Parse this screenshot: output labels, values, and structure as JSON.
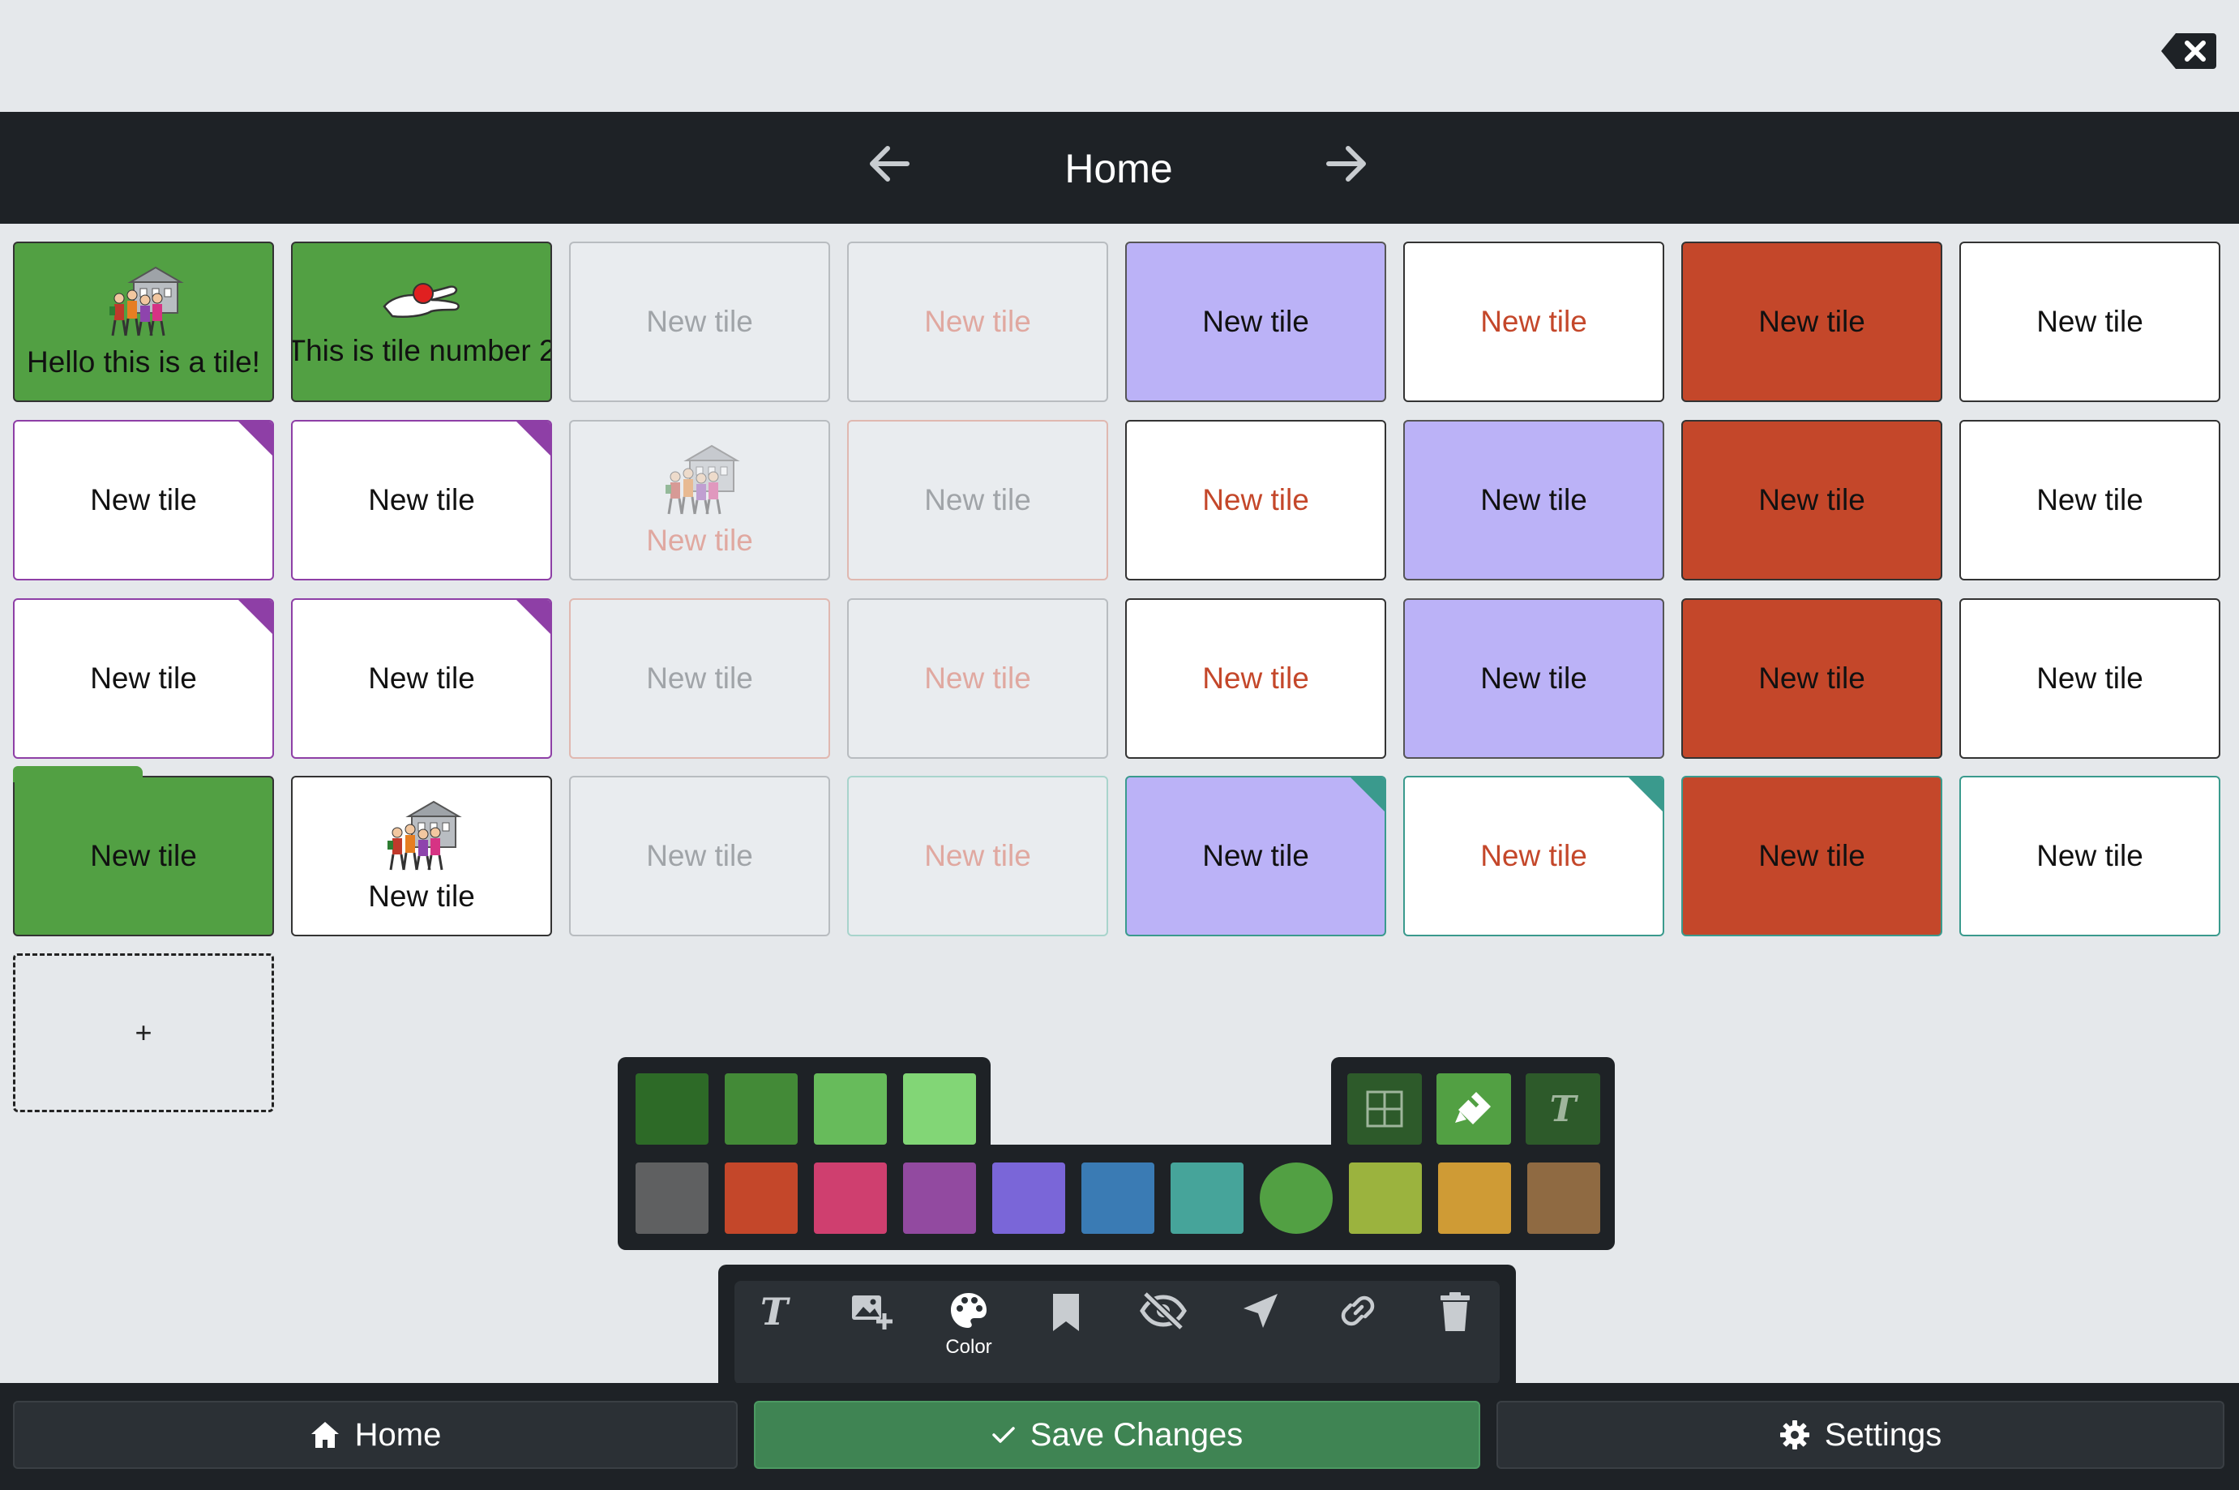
{
  "header": {
    "title": "Home"
  },
  "tiles": [
    {
      "label": "Hello this is a tile!",
      "bg": "#52a043",
      "color": "#111111",
      "border": "#333333",
      "pic": "people-school"
    },
    {
      "label": "This is tile number 2",
      "bg": "#52a043",
      "color": "#111111",
      "border": "#333333",
      "pic": "hand-giving"
    },
    {
      "label": "New tile",
      "bg": "#e9ecef",
      "color": "#a0a4a8",
      "border": "#b8bcc0"
    },
    {
      "label": "New tile",
      "bg": "#e9ecef",
      "color": "#e0a8a0",
      "border": "#b8bcc0"
    },
    {
      "label": "New tile",
      "bg": "#bbb2f7",
      "color": "#111111",
      "border": "#555555"
    },
    {
      "label": "New tile",
      "bg": "#ffffff",
      "color": "#c4472a",
      "border": "#333333"
    },
    {
      "label": "New tile",
      "bg": "#c4472a",
      "color": "#111111",
      "border": "#333333"
    },
    {
      "label": "New tile",
      "bg": "#ffffff",
      "color": "#111111",
      "border": "#333333"
    },
    {
      "label": "New tile",
      "bg": "#ffffff",
      "color": "#111111",
      "border": "#8e3fa6",
      "corner": "purple"
    },
    {
      "label": "New tile",
      "bg": "#ffffff",
      "color": "#111111",
      "border": "#8e3fa6",
      "corner": "purple"
    },
    {
      "label": "New tile",
      "bg": "#e9ecef",
      "color": "#e0a8a0",
      "border": "#b8bcc0",
      "pic": "people-school-faded"
    },
    {
      "label": "New tile",
      "bg": "#e9ecef",
      "color": "#a0a4a8",
      "border": "#e0b8b0"
    },
    {
      "label": "New tile",
      "bg": "#ffffff",
      "color": "#c4472a",
      "border": "#333333"
    },
    {
      "label": "New tile",
      "bg": "#bbb2f7",
      "color": "#111111",
      "border": "#555555"
    },
    {
      "label": "New tile",
      "bg": "#c4472a",
      "color": "#111111",
      "border": "#333333"
    },
    {
      "label": "New tile",
      "bg": "#ffffff",
      "color": "#111111",
      "border": "#333333"
    },
    {
      "label": "New tile",
      "bg": "#ffffff",
      "color": "#111111",
      "border": "#8e3fa6",
      "corner": "purple"
    },
    {
      "label": "New tile",
      "bg": "#ffffff",
      "color": "#111111",
      "border": "#8e3fa6",
      "corner": "purple"
    },
    {
      "label": "New tile",
      "bg": "#e9ecef",
      "color": "#a0a4a8",
      "border": "#e0b8b0"
    },
    {
      "label": "New tile",
      "bg": "#e9ecef",
      "color": "#e0a8a0",
      "border": "#b8bcc0"
    },
    {
      "label": "New tile",
      "bg": "#ffffff",
      "color": "#c4472a",
      "border": "#333333"
    },
    {
      "label": "New tile",
      "bg": "#bbb2f7",
      "color": "#111111",
      "border": "#555555"
    },
    {
      "label": "New tile",
      "bg": "#c4472a",
      "color": "#111111",
      "border": "#333333"
    },
    {
      "label": "New tile",
      "bg": "#ffffff",
      "color": "#111111",
      "border": "#333333"
    },
    {
      "label": "New tile",
      "bg": "#52a043",
      "color": "#111111",
      "border": "#333333",
      "folder": true
    },
    {
      "label": "New tile",
      "bg": "#ffffff",
      "color": "#111111",
      "border": "#333333",
      "pic": "people-school"
    },
    {
      "label": "New tile",
      "bg": "#e9ecef",
      "color": "#a0a4a8",
      "border": "#b8bcc0"
    },
    {
      "label": "New tile",
      "bg": "#e9ecef",
      "color": "#e0a8a0",
      "border": "#a8d4cc"
    },
    {
      "label": "New tile",
      "bg": "#bbb2f7",
      "color": "#111111",
      "border": "#3a9a8d",
      "corner": "teal"
    },
    {
      "label": "New tile",
      "bg": "#ffffff",
      "color": "#c4472a",
      "border": "#3a9a8d",
      "corner": "teal"
    },
    {
      "label": "New tile",
      "bg": "#c4472a",
      "color": "#111111",
      "border": "#3a9a8d"
    },
    {
      "label": "New tile",
      "bg": "#ffffff",
      "color": "#111111",
      "border": "#3a9a8d"
    }
  ],
  "add_tile": {
    "label": "+"
  },
  "palette": {
    "green_shades": [
      "#2d6a27",
      "#438a37",
      "#67bb5b",
      "#82d676"
    ],
    "colors": [
      "#5f6061",
      "#c4472a",
      "#cf3f6f",
      "#924aa0",
      "#7a66d8",
      "#3a7bb4",
      "#46a49a",
      "#52a043",
      "#9bb33e",
      "#cf9b35",
      "#8f6a42"
    ],
    "selected_index": 7,
    "modes": [
      {
        "name": "grid",
        "icon": "grid-icon",
        "bg": "#2d5a2a"
      },
      {
        "name": "fill",
        "icon": "paint-bucket-icon",
        "bg": "#52a043"
      },
      {
        "name": "text",
        "icon": "text-style-icon",
        "bg": "#2d5a2a"
      }
    ]
  },
  "toolbar": {
    "tools": [
      {
        "icon": "text-icon",
        "label": ""
      },
      {
        "icon": "add-image-icon",
        "label": ""
      },
      {
        "icon": "palette-icon",
        "label": "Color"
      },
      {
        "icon": "bookmark-icon",
        "label": ""
      },
      {
        "icon": "eye-slash-icon",
        "label": ""
      },
      {
        "icon": "navigate-icon",
        "label": ""
      },
      {
        "icon": "link-icon",
        "label": ""
      },
      {
        "icon": "trash-icon",
        "label": ""
      }
    ]
  },
  "bottom": {
    "home_label": "Home",
    "save_label": "Save Changes",
    "settings_label": "Settings",
    "save_bg": "#3f8453"
  }
}
